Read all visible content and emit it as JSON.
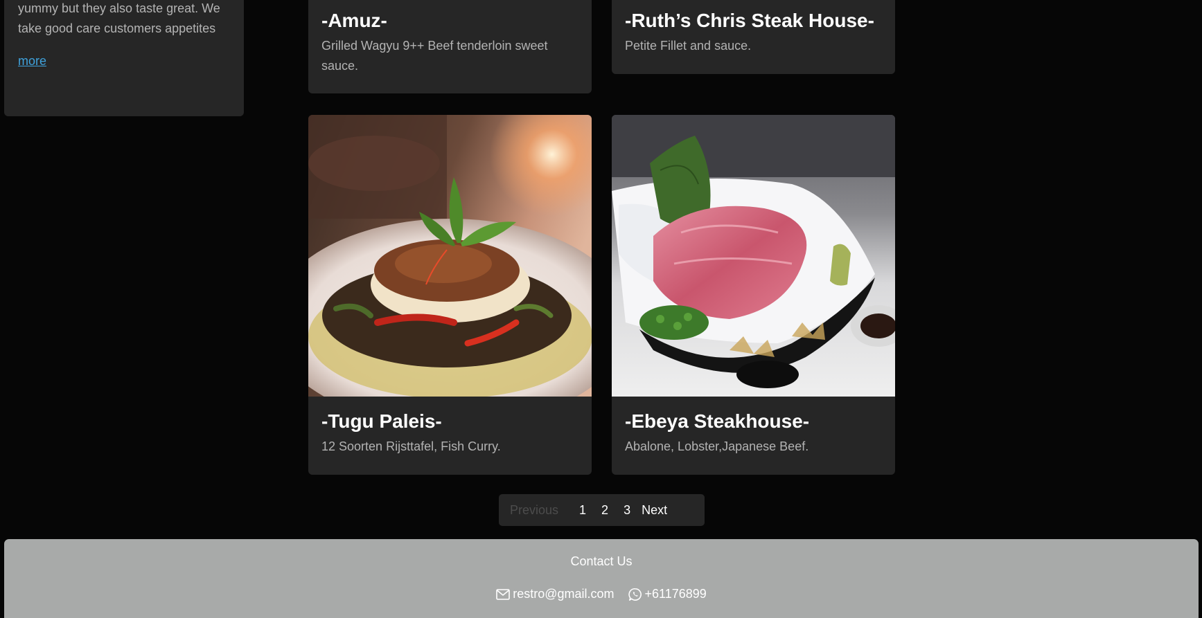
{
  "about": {
    "text": "yummy but they also taste great. We take good care customers appetites",
    "more_label": "more"
  },
  "restaurants": [
    {
      "name": "-Amuz-",
      "description": "Grilled Wagyu 9++ Beef tenderloin sweet sauce."
    },
    {
      "name": "-Ruth’s Chris Steak House-",
      "description": "Petite Fillet and sauce."
    },
    {
      "name": "-Tugu Paleis-",
      "description": "12 Soorten Rijsttafel, Fish Curry."
    },
    {
      "name": "-Ebeya Steakhouse-",
      "description": "Abalone, Lobster,Japanese Beef."
    }
  ],
  "pagination": {
    "previous_label": "Previous",
    "pages": [
      "1",
      "2",
      "3"
    ],
    "next_label": "Next"
  },
  "footer": {
    "title": "Contact Us",
    "email": "restro@gmail.com",
    "phone": "+61176899",
    "email_icon": "envelope-icon",
    "phone_icon": "whatsapp-icon"
  },
  "colors": {
    "background": "#060606",
    "card": "#262626",
    "link": "#3fa2dc",
    "footer": "#a8aaa9"
  }
}
